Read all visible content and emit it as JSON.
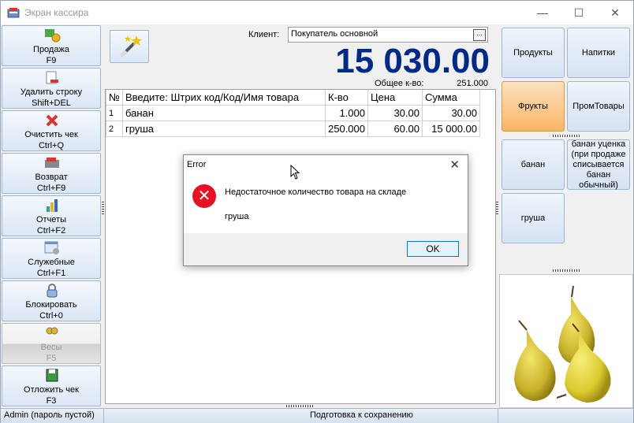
{
  "window": {
    "title": "Экран кассира"
  },
  "menu": [
    {
      "label": "Продажа",
      "shortcut": "F9",
      "icon": "cash-register-icon"
    },
    {
      "label": "Удалить строку",
      "shortcut": "Shift+DEL",
      "icon": "delete-row-icon"
    },
    {
      "label": "Очистить чек",
      "shortcut": "Ctrl+Q",
      "icon": "clear-receipt-icon"
    },
    {
      "label": "Возврат",
      "shortcut": "Ctrl+F9",
      "icon": "return-icon"
    },
    {
      "label": "Отчеты",
      "shortcut": "Ctrl+F2",
      "icon": "reports-icon"
    },
    {
      "label": "Служебные",
      "shortcut": "Ctrl+F1",
      "icon": "service-icon"
    },
    {
      "label": "Блокировать",
      "shortcut": "Ctrl+0",
      "icon": "lock-icon"
    },
    {
      "label": "Весы",
      "shortcut": "F5",
      "icon": "scales-icon",
      "disabled": true
    },
    {
      "label": "Отложить чек",
      "shortcut": "F3",
      "icon": "save-icon"
    }
  ],
  "client": {
    "label": "Клиент:",
    "value": "Покупатель основной",
    "button": "..."
  },
  "totals": {
    "sum": "15 030.00",
    "qty_label": "Общее к-во:",
    "qty_value": "251.000"
  },
  "grid": {
    "headers": [
      "№",
      "Введите: Штрих код/Код/Имя товара",
      "К-во",
      "Цена",
      "Сумма"
    ],
    "rows": [
      [
        "1",
        "банан",
        "1.000",
        "30.00",
        "30.00"
      ],
      [
        "2",
        "груша",
        "250.000",
        "60.00",
        "15 000.00"
      ]
    ]
  },
  "categories": [
    {
      "label": "Продукты"
    },
    {
      "label": "Напитки"
    },
    {
      "label": "Фрукты",
      "active": true
    },
    {
      "label": "ПромТовары"
    }
  ],
  "products": [
    {
      "label": "банан"
    },
    {
      "label": "банан уценка (при продаже списывается банан обычный)"
    },
    {
      "label": "груша"
    }
  ],
  "status": {
    "user": "Admin (пароль пустой)",
    "message": "Подготовка к сохранению"
  },
  "dialog": {
    "title": "Error",
    "message": "Недостаточное количество товара на складе",
    "item": "груша",
    "ok": "OK"
  },
  "colors": {
    "total": "#002a8a",
    "active_category": "#f8b566",
    "error": "#e81123"
  }
}
